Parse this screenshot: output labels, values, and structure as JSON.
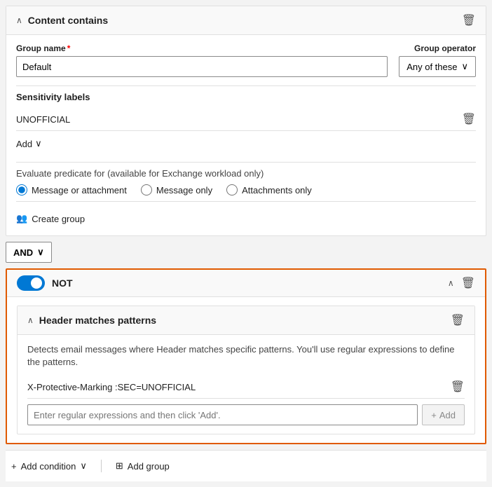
{
  "contentContains": {
    "title": "Content contains",
    "groupNameLabel": "Group name",
    "groupNameValue": "Default",
    "groupOperatorLabel": "Group operator",
    "groupOperatorValue": "Any of these",
    "sensitivityLabelsTitle": "Sensitivity labels",
    "unofficialLabel": "UNOFFICIAL",
    "addButtonLabel": "Add",
    "evaluateLabel": "Evaluate predicate for (available for Exchange workload only)",
    "radioOptions": [
      {
        "id": "msg-or-attach",
        "label": "Message or attachment",
        "checked": true
      },
      {
        "id": "msg-only",
        "label": "Message only",
        "checked": false
      },
      {
        "id": "attach-only",
        "label": "Attachments only",
        "checked": false
      }
    ],
    "createGroupLabel": "Create group"
  },
  "andOperator": {
    "label": "AND"
  },
  "notSection": {
    "notLabel": "NOT",
    "toggleOn": true,
    "headerMatchesTitle": "Header matches patterns",
    "description": "Detects email messages where Header matches specific patterns. You'll use regular expressions to define the patterns.",
    "patternValue": "X-Protective-Marking :SEC=UNOFFICIAL",
    "regexPlaceholder": "Enter regular expressions and then click 'Add'.",
    "addLabel": "Add"
  },
  "bottomToolbar": {
    "addConditionLabel": "Add condition",
    "addGroupLabel": "Add group"
  },
  "icons": {
    "chevronUp": "∧",
    "chevronDown": "∨",
    "trash": "🗑",
    "plus": "+",
    "people": "👥",
    "addGroup": "⊞"
  }
}
